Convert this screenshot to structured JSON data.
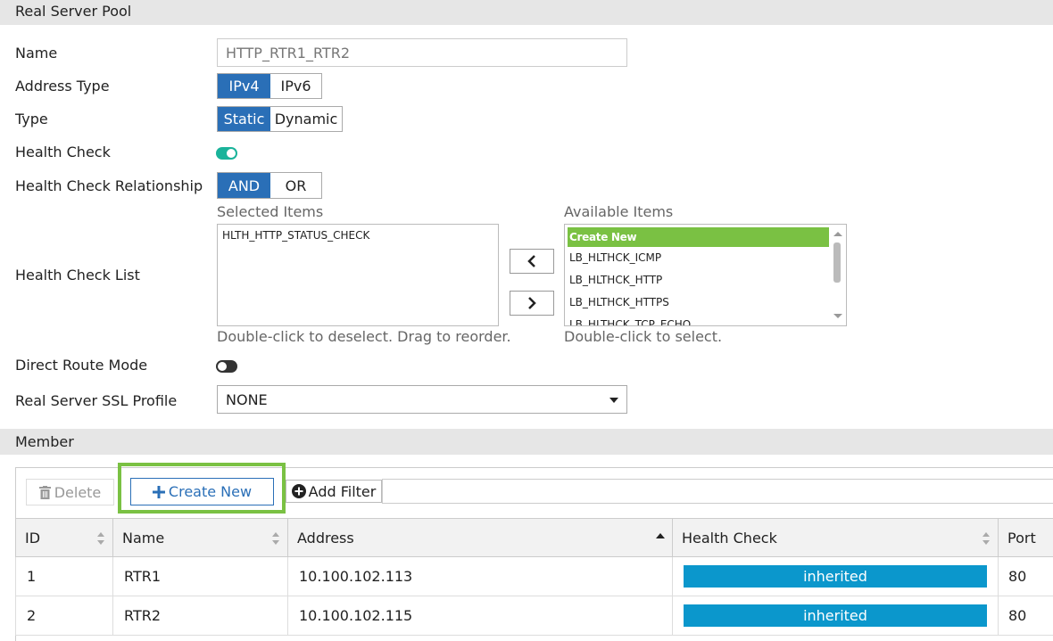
{
  "section_pool": {
    "title": "Real Server Pool"
  },
  "form": {
    "name": {
      "label": "Name",
      "value": "HTTP_RTR1_RTR2"
    },
    "address_type": {
      "label": "Address Type",
      "options": [
        "IPv4",
        "IPv6"
      ],
      "selected": "IPv4"
    },
    "type": {
      "label": "Type",
      "options": [
        "Static",
        "Dynamic"
      ],
      "selected": "Static"
    },
    "health_check": {
      "label": "Health Check",
      "enabled": true
    },
    "health_check_relationship": {
      "label": "Health Check Relationship",
      "options": [
        "AND",
        "OR"
      ],
      "selected": "AND"
    },
    "health_check_list": {
      "label": "Health Check List",
      "selected_title": "Selected Items",
      "selected_items": [
        "HLTH_HTTP_STATUS_CHECK"
      ],
      "selected_hint": "Double-click to deselect. Drag to reorder.",
      "available_title": "Available Items",
      "available_items": [
        "Create New",
        "LB_HLTHCK_ICMP",
        "LB_HLTHCK_HTTP",
        "LB_HLTHCK_HTTPS",
        "LB_HLTHCK_TCP_ECHO"
      ],
      "available_hint": "Double-click to select."
    },
    "direct_route_mode": {
      "label": "Direct Route Mode",
      "enabled": false
    },
    "ssl_profile": {
      "label": "Real Server SSL Profile",
      "value": "NONE"
    }
  },
  "section_member": {
    "title": "Member"
  },
  "toolbar": {
    "delete_label": "Delete",
    "create_new_label": "Create New",
    "add_filter_label": "Add Filter"
  },
  "table": {
    "columns": [
      "ID",
      "Name",
      "Address",
      "Health Check",
      "Port"
    ],
    "rows": [
      {
        "id": "1",
        "name": "RTR1",
        "address": "10.100.102.113",
        "health_check": "inherited",
        "port": "80"
      },
      {
        "id": "2",
        "name": "RTR2",
        "address": "10.100.102.115",
        "health_check": "inherited",
        "port": "80"
      }
    ]
  },
  "colors": {
    "accent": "#2a6fb7",
    "toggle_on": "#1ab39a",
    "create_new_item": "#7ac143",
    "highlight_border": "#7ac143",
    "badge": "#0b97cc"
  }
}
